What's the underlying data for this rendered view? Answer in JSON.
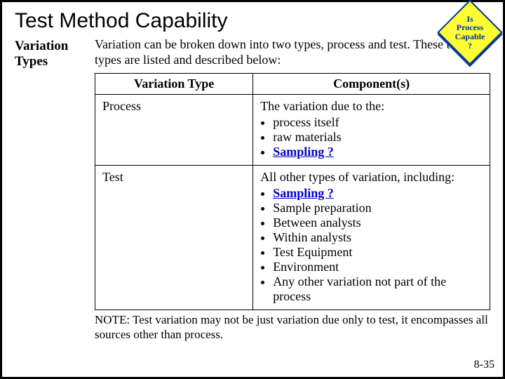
{
  "title": "Test Method Capability",
  "callout": {
    "l1": "Is",
    "l2": "Process",
    "l3": "Capable",
    "l4": "?"
  },
  "side_label": "Variation Types",
  "intro": "Variation can be broken down into two types, process and test.  These two types are listed and described below:",
  "table": {
    "headers": {
      "col1": "Variation Type",
      "col2": "Component(s)"
    },
    "rows": [
      {
        "type": "Process",
        "lead": "The variation due to the:",
        "items": [
          "process itself",
          "raw materials"
        ],
        "emph": "Sampling ?"
      },
      {
        "type": "Test",
        "lead": "All other types of variation, including:",
        "emph": "Sampling ?",
        "items": [
          "Sample preparation",
          "Between analysts",
          "Within analysts",
          "Test Equipment",
          "Environment",
          "Any other variation not part of the process"
        ]
      }
    ]
  },
  "note": "NOTE:  Test variation may not be just variation due only to test, it encompasses all sources other than process.",
  "pagenum": "8-35"
}
